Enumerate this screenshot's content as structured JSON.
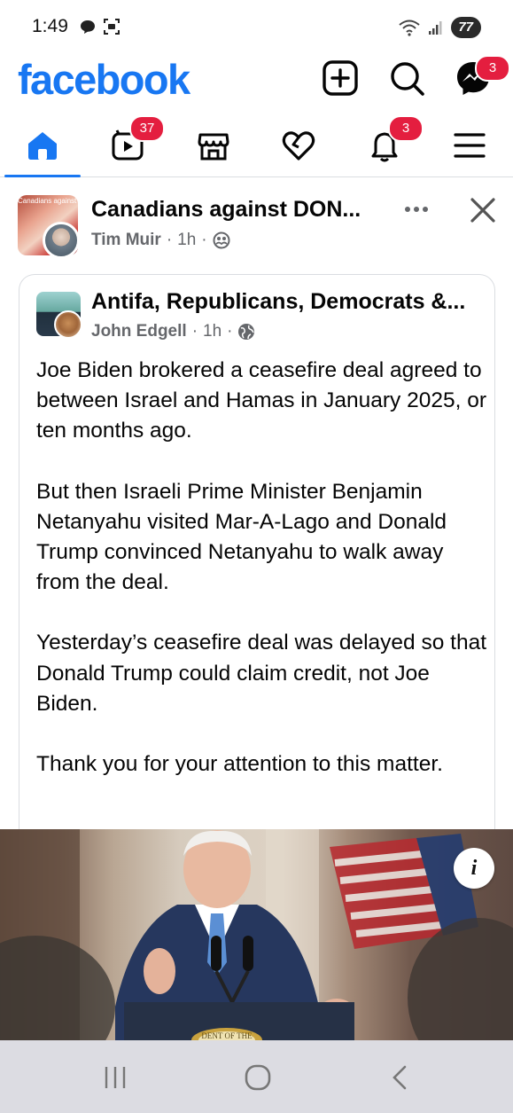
{
  "status_bar": {
    "time": "1:49",
    "battery": "77"
  },
  "header": {
    "logo": "facebook",
    "messenger_badge": "3",
    "icons": [
      "plus-square-icon",
      "search-icon",
      "messenger-icon"
    ]
  },
  "tabs": [
    {
      "name": "home",
      "icon": "home-icon",
      "active": true
    },
    {
      "name": "video",
      "icon": "video-icon",
      "badge": "37"
    },
    {
      "name": "marketplace",
      "icon": "marketplace-icon"
    },
    {
      "name": "dating",
      "icon": "heart-icon"
    },
    {
      "name": "notifications",
      "icon": "bell-icon",
      "badge": "3"
    },
    {
      "name": "menu",
      "icon": "hamburger-icon"
    }
  ],
  "post": {
    "group_avatar_text": "Canadians against DONALD",
    "group_name": "Canadians against DON...",
    "author": "Tim Muir",
    "time": "1h",
    "privacy_icon": "members-icon"
  },
  "shared": {
    "group_name": "Antifa, Republicans, Democrats &...",
    "author": "John Edgell",
    "time": "1h",
    "privacy_icon": "globe-icon",
    "paragraphs": [
      "Joe Biden brokered a ceasefire deal agreed to between Israel and Hamas in January 2025, or ten months ago.",
      "But then Israeli Prime Minister Benjamin Netanyahu visited Mar-A-Lago and Donald Trump convinced Netanyahu to walk away from the deal.",
      "Yesterday’s ceasefire deal was delayed so that Donald Trump could claim credit, not Joe Biden.",
      "Thank you for your attention to this matter."
    ]
  },
  "image": {
    "info_label": "i",
    "seal_text": "DENT OF THE"
  },
  "colors": {
    "brand": "#1877f2",
    "badge": "#e41e3f",
    "meta": "#65676b"
  }
}
